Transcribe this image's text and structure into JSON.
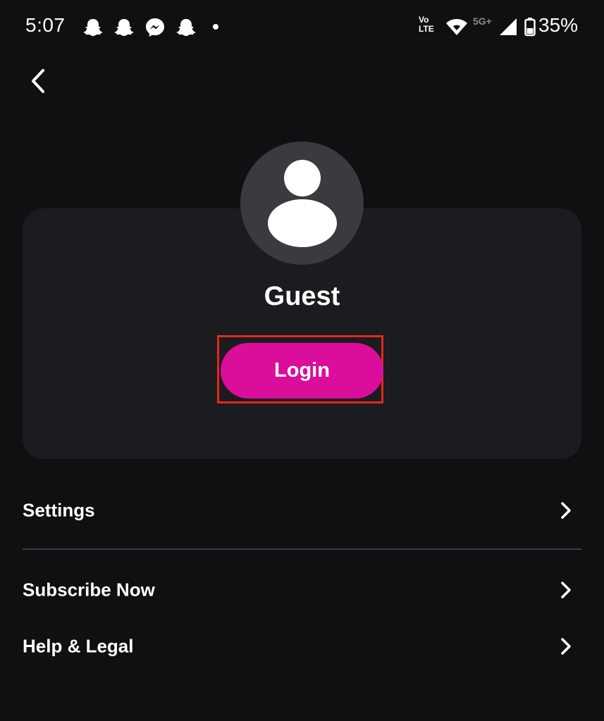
{
  "status_bar": {
    "time": "5:07",
    "notifications": [
      "snapchat-icon",
      "snapchat-icon",
      "messenger-icon",
      "snapchat-icon"
    ],
    "network_top": "Vo",
    "network_bottom": "LTE",
    "network_5g": "5G+",
    "battery_percent": "35%"
  },
  "profile": {
    "name": "Guest",
    "login_label": "Login"
  },
  "menu": {
    "items": [
      {
        "label": "Settings"
      },
      {
        "label": "Subscribe Now"
      },
      {
        "label": "Help & Legal"
      }
    ]
  },
  "colors": {
    "background": "#0f1012",
    "card": "#1b1c1f",
    "avatar": "#3a3b3e",
    "accent": "#db0d9b",
    "highlight": "#e5271b"
  }
}
